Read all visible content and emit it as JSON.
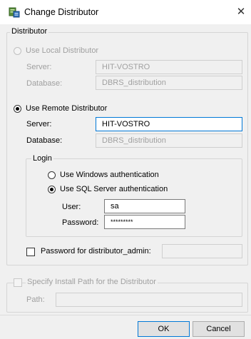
{
  "window": {
    "title": "Change Distributor",
    "close_glyph": "✕",
    "icon": "database-server-icon"
  },
  "distributor_group": {
    "legend": "Distributor"
  },
  "local": {
    "label": "Use Local Distributor",
    "server_label": "Server:",
    "server_value": "HIT-VOSTRO",
    "database_label": "Database:",
    "database_value": "DBRS_distribution",
    "selected": false,
    "enabled": false
  },
  "remote": {
    "label": "Use Remote Distributor",
    "server_label": "Server:",
    "server_value": "HIT-VOSTRO",
    "database_label": "Database:",
    "database_value": "DBRS_distribution",
    "selected": true
  },
  "login": {
    "legend": "Login",
    "windows_auth_label": "Use Windows authentication",
    "sql_auth_label": "Use SQL Server authentication",
    "selected": "sql",
    "user_label": "User:",
    "user_value": "sa",
    "password_label": "Password:",
    "password_value": "*********"
  },
  "distributor_admin": {
    "label": "Password for distributor_admin:",
    "checked": false,
    "value": ""
  },
  "install_path": {
    "label": "Specify Install Path for the Distributor",
    "path_label": "Path:",
    "path_value": "",
    "checked": false,
    "enabled": false
  },
  "buttons": {
    "ok": "OK",
    "cancel": "Cancel"
  },
  "colors": {
    "focus_accent": "#0078d7",
    "disabled_text": "#a0a0a0"
  }
}
